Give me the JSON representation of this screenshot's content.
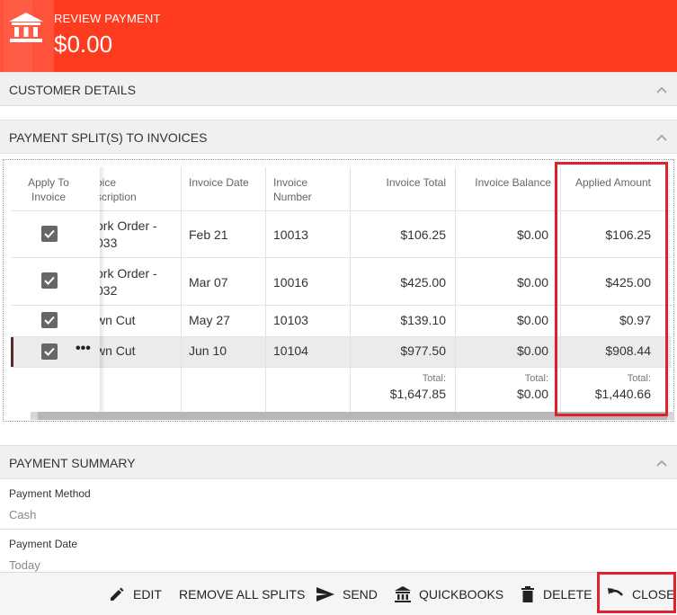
{
  "header": {
    "title": "REVIEW PAYMENT",
    "amount": "$0.00",
    "icon": "bank-icon",
    "color": "#ff3b1f"
  },
  "sections": {
    "customer_details": "CUSTOMER DETAILS",
    "payment_splits": "PAYMENT SPLIT(S) TO INVOICES",
    "payment_summary": "PAYMENT SUMMARY"
  },
  "grid": {
    "columns": {
      "apply_l1": "Apply To",
      "apply_l2": "Invoice",
      "desc_l1": "oice",
      "desc_l2": "scription",
      "date": "Invoice Date",
      "num_l1": "Invoice",
      "num_l2": "Number",
      "total": "Invoice Total",
      "balance": "Invoice Balance",
      "applied": "Applied Amount"
    },
    "rows": [
      {
        "desc_l1": "ork Order -",
        "desc_l2": "033",
        "date": "Feb 21",
        "number": "10013",
        "total": "$106.25",
        "balance": "$0.00",
        "applied": "$106.25"
      },
      {
        "desc_l1": "ork Order -",
        "desc_l2": "032",
        "date": "Mar 07",
        "number": "10016",
        "total": "$425.00",
        "balance": "$0.00",
        "applied": "$425.00"
      },
      {
        "desc_l1": "wn Cut",
        "desc_l2": "",
        "date": "May 27",
        "number": "10103",
        "total": "$139.10",
        "balance": "$0.00",
        "applied": "$0.97"
      },
      {
        "desc_l1": "wn Cut",
        "desc_l2": "",
        "date": "Jun 10",
        "number": "10104",
        "total": "$977.50",
        "balance": "$0.00",
        "applied": "$908.44"
      }
    ],
    "more_actions": "•••",
    "totals": {
      "label": "Total:",
      "total": "$1,647.85",
      "balance": "$0.00",
      "applied": "$1,440.66"
    }
  },
  "summary": {
    "method_label": "Payment Method",
    "method_value": "Cash",
    "date_label": "Payment Date",
    "date_value": "Today"
  },
  "toolbar": {
    "edit": "EDIT",
    "remove_all": "REMOVE ALL SPLITS",
    "send": "SEND",
    "quickbooks": "QUICKBOOKS",
    "delete": "DELETE",
    "close": "CLOSE"
  },
  "colors": {
    "highlight": "#e0202c",
    "accent": "#ff3b1f"
  }
}
